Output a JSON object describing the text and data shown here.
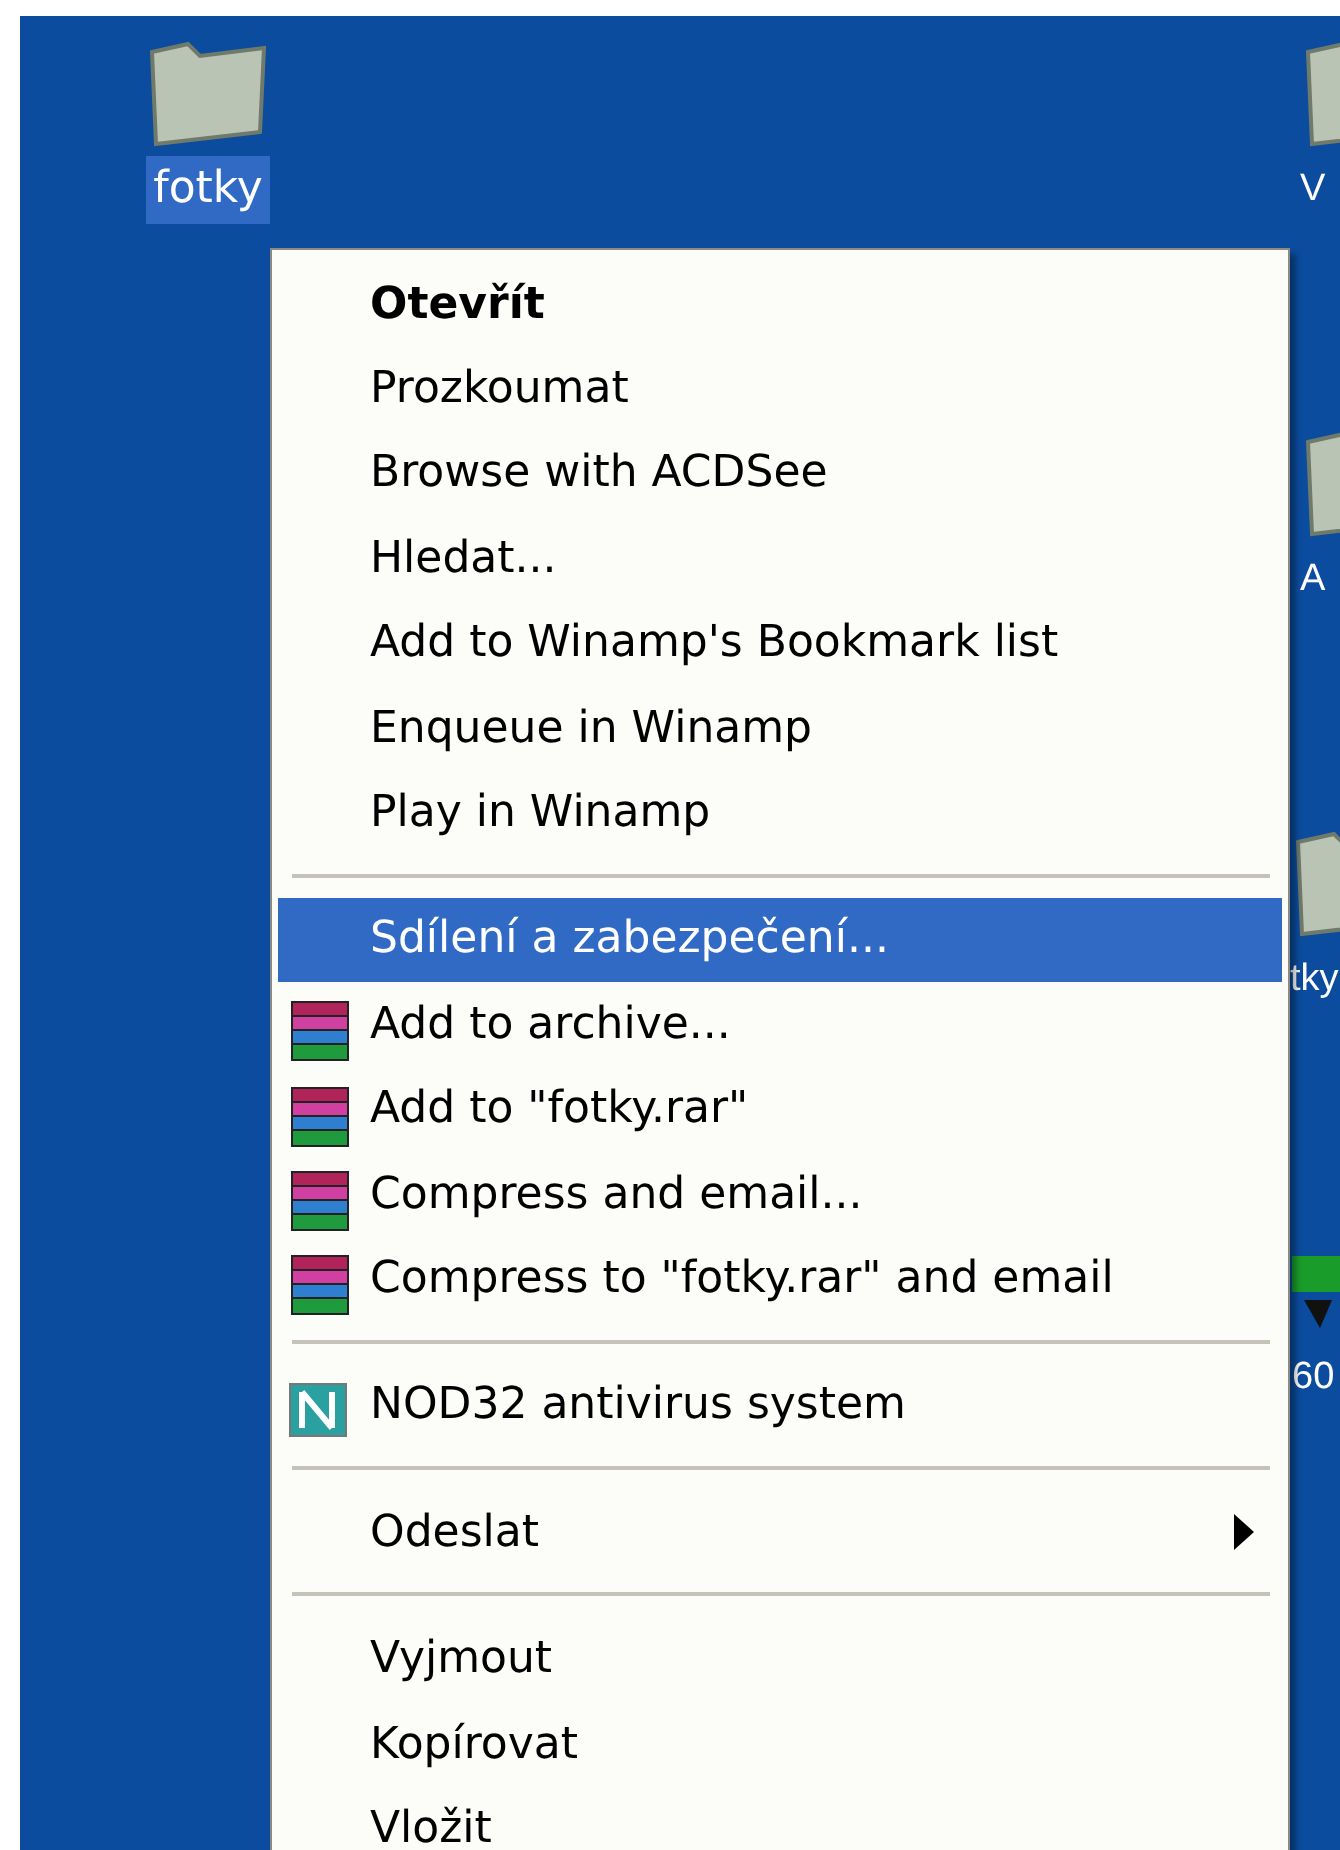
{
  "desktop_icons": [
    {
      "label": "fotky",
      "kind": "folder",
      "selected": true
    },
    {
      "label": "V",
      "kind": "folder",
      "selected": false
    },
    {
      "label": "A",
      "kind": "folder",
      "selected": false
    },
    {
      "label": "tky",
      "kind": "folder",
      "selected": false
    },
    {
      "label": "60",
      "kind": "device",
      "selected": false
    }
  ],
  "context_menu": {
    "items": [
      {
        "kind": "item",
        "label": "Otevřít",
        "default": true,
        "selected": false
      },
      {
        "kind": "item",
        "label": "Prozkoumat",
        "selected": false
      },
      {
        "kind": "item",
        "label": "Browse with ACDSee",
        "selected": false
      },
      {
        "kind": "item",
        "label": "Hledat...",
        "selected": false
      },
      {
        "kind": "item",
        "label": "Add to Winamp's Bookmark list",
        "selected": false
      },
      {
        "kind": "item",
        "label": "Enqueue in Winamp",
        "selected": false
      },
      {
        "kind": "item",
        "label": "Play in Winamp",
        "selected": false
      },
      {
        "kind": "separator"
      },
      {
        "kind": "item",
        "label": "Sdílení a zabezpečení...",
        "selected": true
      },
      {
        "kind": "archiver",
        "label": "Add to archive...",
        "selected": false
      },
      {
        "kind": "archiver",
        "label": "Add to \"fotky.rar\"",
        "selected": false
      },
      {
        "kind": "archiver",
        "label": "Compress and email...",
        "selected": false
      },
      {
        "kind": "archiver",
        "label": "Compress to \"fotky.rar\" and email",
        "selected": false
      },
      {
        "kind": "separator"
      },
      {
        "kind": "antivirus",
        "label": "NOD32 antivirus system",
        "selected": false
      },
      {
        "kind": "separator"
      },
      {
        "kind": "item",
        "label": "Odeslat",
        "submenu": true,
        "selected": false
      },
      {
        "kind": "separator"
      },
      {
        "kind": "item",
        "label": "Vyjmout",
        "selected": false
      },
      {
        "kind": "item",
        "label": "Kopírovat",
        "selected": false
      },
      {
        "kind": "item",
        "label": "Vložit",
        "selected": false
      }
    ]
  }
}
